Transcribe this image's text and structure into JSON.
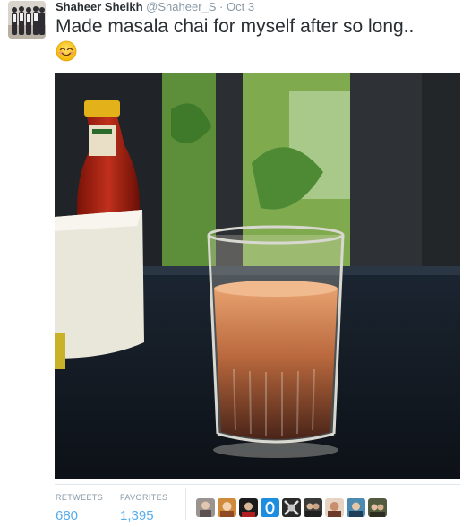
{
  "tweet": {
    "author_name": "Shaheer Sheikh",
    "handle": "@Shaheer_S",
    "separator": "·",
    "date": "Oct 3",
    "text": "Made masala chai for myself after so long..",
    "emoji": "smiling-face-emoji"
  },
  "stats": {
    "retweets_label": "RETWEETS",
    "retweets_value": "680",
    "favorites_label": "FAVORITES",
    "favorites_value": "1,395"
  },
  "colors": {
    "link_blue": "#55acee",
    "muted_gray": "#8899a6",
    "text_dark": "#292f33",
    "divider": "#e1e8ed"
  }
}
